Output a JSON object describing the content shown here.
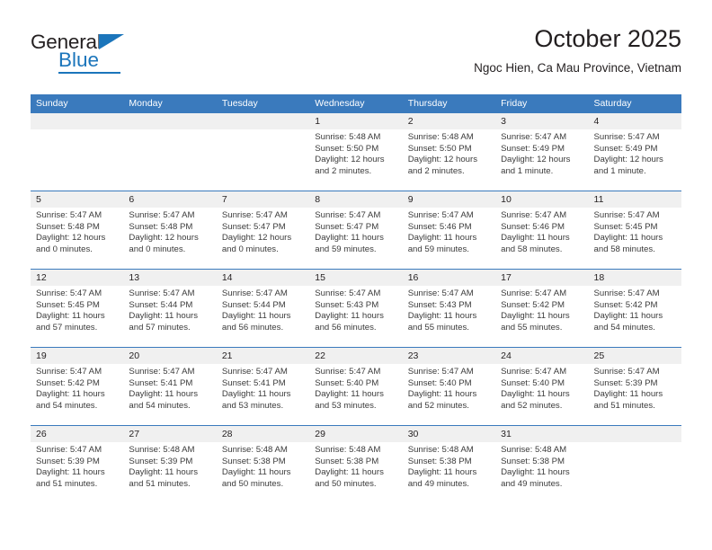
{
  "brand": {
    "word_one": "General",
    "word_two": "Blue",
    "triangle_icon": "triangle-icon"
  },
  "header": {
    "month_title": "October 2025",
    "location": "Ngoc Hien, Ca Mau Province, Vietnam"
  },
  "calendar": {
    "accent_color": "#3a7abd",
    "daynum_band_color": "#f0f0f0",
    "day_headers": [
      "Sunday",
      "Monday",
      "Tuesday",
      "Wednesday",
      "Thursday",
      "Friday",
      "Saturday"
    ],
    "weeks": [
      [
        {
          "day": "",
          "lines": []
        },
        {
          "day": "",
          "lines": []
        },
        {
          "day": "",
          "lines": []
        },
        {
          "day": "1",
          "lines": [
            "Sunrise: 5:48 AM",
            "Sunset: 5:50 PM",
            "Daylight: 12 hours",
            "and 2 minutes."
          ]
        },
        {
          "day": "2",
          "lines": [
            "Sunrise: 5:48 AM",
            "Sunset: 5:50 PM",
            "Daylight: 12 hours",
            "and 2 minutes."
          ]
        },
        {
          "day": "3",
          "lines": [
            "Sunrise: 5:47 AM",
            "Sunset: 5:49 PM",
            "Daylight: 12 hours",
            "and 1 minute."
          ]
        },
        {
          "day": "4",
          "lines": [
            "Sunrise: 5:47 AM",
            "Sunset: 5:49 PM",
            "Daylight: 12 hours",
            "and 1 minute."
          ]
        }
      ],
      [
        {
          "day": "5",
          "lines": [
            "Sunrise: 5:47 AM",
            "Sunset: 5:48 PM",
            "Daylight: 12 hours",
            "and 0 minutes."
          ]
        },
        {
          "day": "6",
          "lines": [
            "Sunrise: 5:47 AM",
            "Sunset: 5:48 PM",
            "Daylight: 12 hours",
            "and 0 minutes."
          ]
        },
        {
          "day": "7",
          "lines": [
            "Sunrise: 5:47 AM",
            "Sunset: 5:47 PM",
            "Daylight: 12 hours",
            "and 0 minutes."
          ]
        },
        {
          "day": "8",
          "lines": [
            "Sunrise: 5:47 AM",
            "Sunset: 5:47 PM",
            "Daylight: 11 hours",
            "and 59 minutes."
          ]
        },
        {
          "day": "9",
          "lines": [
            "Sunrise: 5:47 AM",
            "Sunset: 5:46 PM",
            "Daylight: 11 hours",
            "and 59 minutes."
          ]
        },
        {
          "day": "10",
          "lines": [
            "Sunrise: 5:47 AM",
            "Sunset: 5:46 PM",
            "Daylight: 11 hours",
            "and 58 minutes."
          ]
        },
        {
          "day": "11",
          "lines": [
            "Sunrise: 5:47 AM",
            "Sunset: 5:45 PM",
            "Daylight: 11 hours",
            "and 58 minutes."
          ]
        }
      ],
      [
        {
          "day": "12",
          "lines": [
            "Sunrise: 5:47 AM",
            "Sunset: 5:45 PM",
            "Daylight: 11 hours",
            "and 57 minutes."
          ]
        },
        {
          "day": "13",
          "lines": [
            "Sunrise: 5:47 AM",
            "Sunset: 5:44 PM",
            "Daylight: 11 hours",
            "and 57 minutes."
          ]
        },
        {
          "day": "14",
          "lines": [
            "Sunrise: 5:47 AM",
            "Sunset: 5:44 PM",
            "Daylight: 11 hours",
            "and 56 minutes."
          ]
        },
        {
          "day": "15",
          "lines": [
            "Sunrise: 5:47 AM",
            "Sunset: 5:43 PM",
            "Daylight: 11 hours",
            "and 56 minutes."
          ]
        },
        {
          "day": "16",
          "lines": [
            "Sunrise: 5:47 AM",
            "Sunset: 5:43 PM",
            "Daylight: 11 hours",
            "and 55 minutes."
          ]
        },
        {
          "day": "17",
          "lines": [
            "Sunrise: 5:47 AM",
            "Sunset: 5:42 PM",
            "Daylight: 11 hours",
            "and 55 minutes."
          ]
        },
        {
          "day": "18",
          "lines": [
            "Sunrise: 5:47 AM",
            "Sunset: 5:42 PM",
            "Daylight: 11 hours",
            "and 54 minutes."
          ]
        }
      ],
      [
        {
          "day": "19",
          "lines": [
            "Sunrise: 5:47 AM",
            "Sunset: 5:42 PM",
            "Daylight: 11 hours",
            "and 54 minutes."
          ]
        },
        {
          "day": "20",
          "lines": [
            "Sunrise: 5:47 AM",
            "Sunset: 5:41 PM",
            "Daylight: 11 hours",
            "and 54 minutes."
          ]
        },
        {
          "day": "21",
          "lines": [
            "Sunrise: 5:47 AM",
            "Sunset: 5:41 PM",
            "Daylight: 11 hours",
            "and 53 minutes."
          ]
        },
        {
          "day": "22",
          "lines": [
            "Sunrise: 5:47 AM",
            "Sunset: 5:40 PM",
            "Daylight: 11 hours",
            "and 53 minutes."
          ]
        },
        {
          "day": "23",
          "lines": [
            "Sunrise: 5:47 AM",
            "Sunset: 5:40 PM",
            "Daylight: 11 hours",
            "and 52 minutes."
          ]
        },
        {
          "day": "24",
          "lines": [
            "Sunrise: 5:47 AM",
            "Sunset: 5:40 PM",
            "Daylight: 11 hours",
            "and 52 minutes."
          ]
        },
        {
          "day": "25",
          "lines": [
            "Sunrise: 5:47 AM",
            "Sunset: 5:39 PM",
            "Daylight: 11 hours",
            "and 51 minutes."
          ]
        }
      ],
      [
        {
          "day": "26",
          "lines": [
            "Sunrise: 5:47 AM",
            "Sunset: 5:39 PM",
            "Daylight: 11 hours",
            "and 51 minutes."
          ]
        },
        {
          "day": "27",
          "lines": [
            "Sunrise: 5:48 AM",
            "Sunset: 5:39 PM",
            "Daylight: 11 hours",
            "and 51 minutes."
          ]
        },
        {
          "day": "28",
          "lines": [
            "Sunrise: 5:48 AM",
            "Sunset: 5:38 PM",
            "Daylight: 11 hours",
            "and 50 minutes."
          ]
        },
        {
          "day": "29",
          "lines": [
            "Sunrise: 5:48 AM",
            "Sunset: 5:38 PM",
            "Daylight: 11 hours",
            "and 50 minutes."
          ]
        },
        {
          "day": "30",
          "lines": [
            "Sunrise: 5:48 AM",
            "Sunset: 5:38 PM",
            "Daylight: 11 hours",
            "and 49 minutes."
          ]
        },
        {
          "day": "31",
          "lines": [
            "Sunrise: 5:48 AM",
            "Sunset: 5:38 PM",
            "Daylight: 11 hours",
            "and 49 minutes."
          ]
        },
        {
          "day": "",
          "lines": []
        }
      ]
    ]
  }
}
